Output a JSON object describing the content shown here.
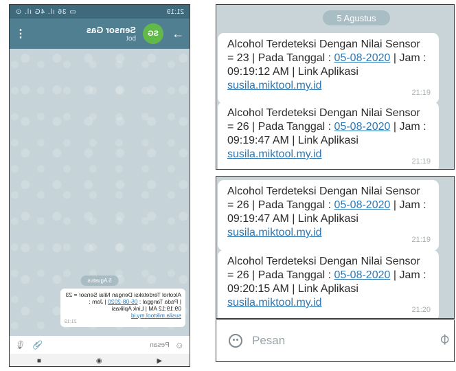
{
  "phone": {
    "status_time": "21:19",
    "status_icons": "▭ 36 ıl. 4G ıl. ⊙",
    "chat_title": "Sensor Gas",
    "chat_subtitle": "bot",
    "avatar_initials": "SG",
    "back_glyph": "→",
    "menu_glyph": "⋮",
    "date_label": "5 Agustus",
    "message": {
      "text": "Alcohol Terdeteksi Dengan Nilai Sensor = 23 | Pada Tanggal : ",
      "date": "05-08-2020",
      "sep": " | Jam : 09:19:12 AM | Link Aplikasi ",
      "link": "susila.miktool.my.id",
      "time": "21:19"
    },
    "input_placeholder": "Pesan",
    "nav": [
      "◀",
      "◉",
      "■"
    ]
  },
  "zoom": {
    "date_label": "5 Agustus",
    "messages": [
      {
        "prefix": "Alcohol Terdeteksi Dengan Nilai Sensor = 23 | Pada Tanggal : ",
        "date": "05-08-2020",
        "middle": " | Jam : 09:19:12 AM | Link Aplikasi ",
        "link": "susila.miktool.my.id",
        "time": "21:19"
      },
      {
        "prefix": "Alcohol Terdeteksi Dengan Nilai Sensor = 26 | Pada Tanggal : ",
        "date": "05-08-2020",
        "middle": " | Jam : 09:19:47 AM | Link Aplikasi ",
        "link": "susila.miktool.my.id",
        "time": "21:19"
      },
      {
        "prefix": "Alcohol Terdeteksi Dengan Nilai Sensor = 26 | Pada Tanggal : ",
        "date": "05-08-2020",
        "middle": " | Jam : 09:19:47 AM | Link Aplikasi ",
        "link": "susila.miktool.my.id",
        "time": "21:19"
      },
      {
        "prefix": "Alcohol Terdeteksi Dengan Nilai Sensor = 26 | Pada Tanggal : ",
        "date": "05-08-2020",
        "middle": " | Jam : 09:20:15 AM | Link Aplikasi ",
        "link": "susila.miktool.my.id",
        "time": "21:20"
      }
    ],
    "input_placeholder": "Pesan"
  }
}
